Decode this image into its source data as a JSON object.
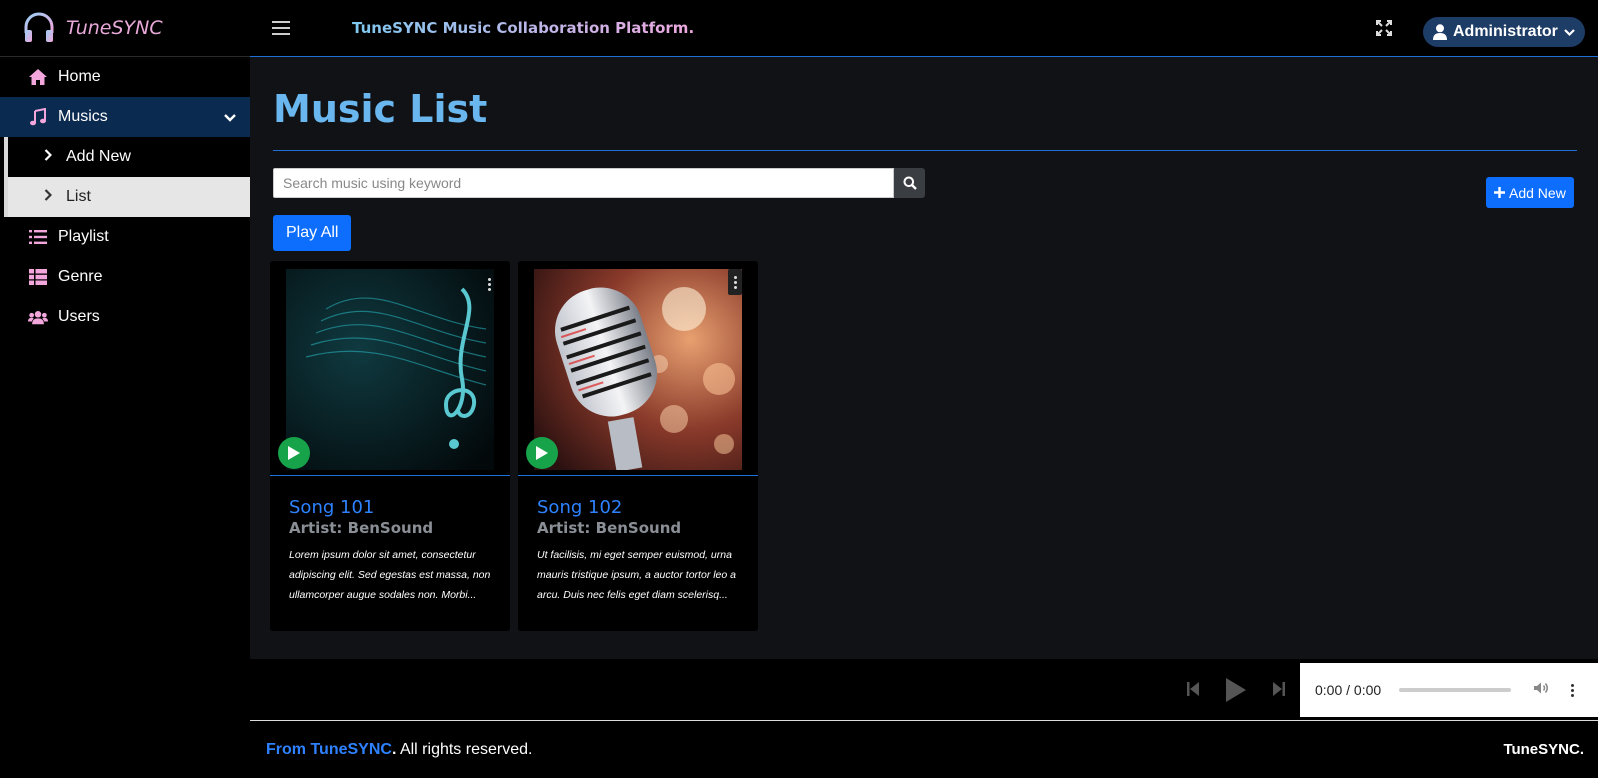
{
  "brand": {
    "name": "TuneSYNC",
    "icon": "headphones-icon"
  },
  "sidebar": {
    "items": [
      {
        "label": "Home",
        "icon": "home-icon"
      },
      {
        "label": "Musics",
        "icon": "music-note-icon"
      },
      {
        "label": "Playlist",
        "icon": "list-icon"
      },
      {
        "label": "Genre",
        "icon": "table-list-icon"
      },
      {
        "label": "Users",
        "icon": "users-icon"
      }
    ],
    "musics_sub": [
      {
        "label": "Add New"
      },
      {
        "label": "List"
      }
    ]
  },
  "header": {
    "title": "TuneSYNC Music Collaboration Platform.",
    "user": "Administrator"
  },
  "main": {
    "page_title": "Music List",
    "search_placeholder": "Search music using keyword",
    "add_new_label": "Add New",
    "play_all_label": "Play All",
    "cards": [
      {
        "title": "Song 101",
        "artist": "Artist: BenSound",
        "description": "Lorem ipsum dolor sit amet, consectetur adipiscing elit. Sed egestas est massa, non ullamcorper augue sodales non. Morbi..."
      },
      {
        "title": "Song 102",
        "artist": "Artist: BenSound",
        "description": "Ut facilisis, mi eget semper euismod, urna mauris tristique ipsum, a auctor tortor leo a arcu. Duis nec felis eget diam scelerisq..."
      }
    ]
  },
  "player": {
    "time": "0:00 / 0:00"
  },
  "footer": {
    "prefix": "From ",
    "brand": "TuneSYNC",
    "dot": ".",
    "rights": " All rights reserved.",
    "right_text": "TuneSYNC."
  },
  "colors": {
    "accent": "#0d6efd",
    "title_blue": "#6ab6ee",
    "active_nav": "#0b2a50",
    "play_green": "#17a34a"
  }
}
